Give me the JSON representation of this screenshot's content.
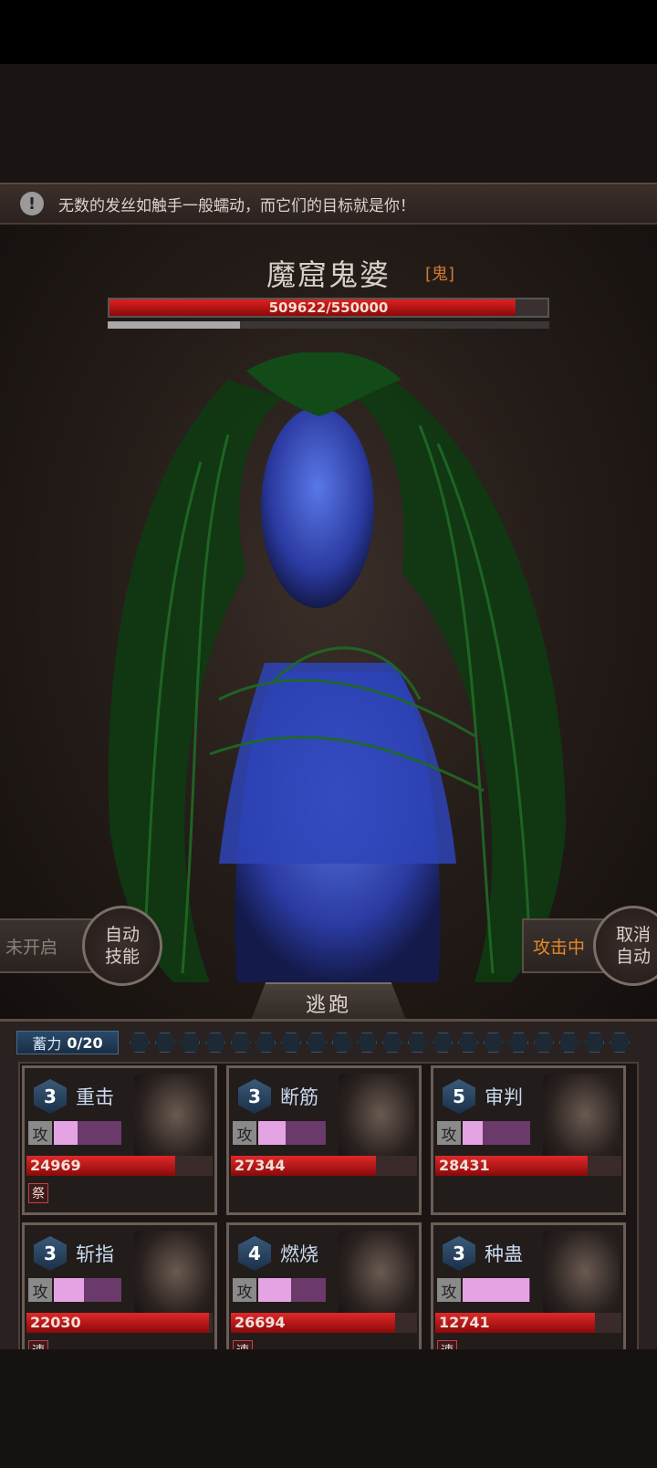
{
  "message": {
    "icon": "warning-icon",
    "text": "无数的发丝如触手一般蠕动，而它们的目标就是你！"
  },
  "boss": {
    "name": "魔窟鬼婆",
    "tag": "[鬼]",
    "hp_text": "509622/550000",
    "hp_fraction": 0.9266,
    "sub_fraction": 0.3
  },
  "controls": {
    "left_status": "未开启",
    "auto_skill": [
      "自动",
      "技能"
    ],
    "right_status": "攻击中",
    "cancel_auto": [
      "取消",
      "自动"
    ],
    "flee": "逃跑"
  },
  "charge": {
    "label": "蓄力",
    "value": "0/20",
    "orb_count": 20,
    "filled": 0
  },
  "cards": [
    {
      "level": "3",
      "skill": "重击",
      "atk_label": "攻",
      "atk_fraction": 0.35,
      "hp": "24969",
      "hp_fraction": 0.8,
      "status": "祭"
    },
    {
      "level": "3",
      "skill": "断筋",
      "atk_label": "攻",
      "atk_fraction": 0.4,
      "hp": "27344",
      "hp_fraction": 0.78,
      "status": ""
    },
    {
      "level": "5",
      "skill": "审判",
      "atk_label": "攻",
      "atk_fraction": 0.3,
      "hp": "28431",
      "hp_fraction": 0.82,
      "status": ""
    },
    {
      "level": "3",
      "skill": "斩指",
      "atk_label": "攻",
      "atk_fraction": 0.45,
      "hp": "22030",
      "hp_fraction": 0.98,
      "status": "速"
    },
    {
      "level": "4",
      "skill": "燃烧",
      "atk_label": "攻",
      "atk_fraction": 0.48,
      "hp": "26694",
      "hp_fraction": 0.88,
      "status": "速"
    },
    {
      "level": "3",
      "skill": "种蛊",
      "atk_label": "攻",
      "atk_fraction": 0.98,
      "hp": "12741",
      "hp_fraction": 0.86,
      "status": "速"
    }
  ]
}
